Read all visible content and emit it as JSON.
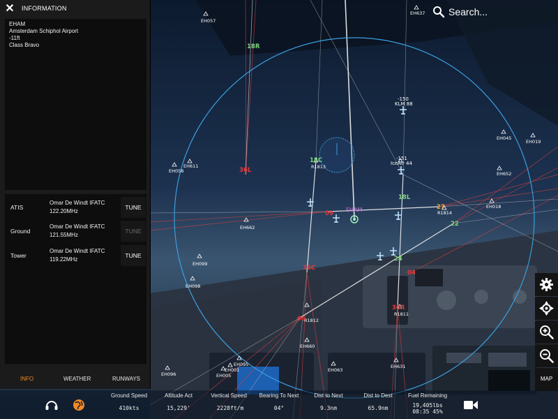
{
  "colors": {
    "accent": "#f08a2a",
    "runway_label": "#e53a3a",
    "runway_label_lit": "#7dd67d",
    "runway_label_orange": "#f0a030",
    "radius_circle": "#3a9fe0",
    "waypoint_text": "#ffffff"
  },
  "info_panel": {
    "close_icon": "close-icon",
    "title": "INFORMATION",
    "airport": {
      "icao": "EHAM",
      "name": "Amsterdam Schiphol Airport",
      "elevation": "-11ft",
      "class": "Class Bravo"
    },
    "frequencies": [
      {
        "type": "ATIS",
        "controller": "Omar De Windt IFATC",
        "mhz": "122.20MHz",
        "tune_label": "TUNE",
        "enabled": true
      },
      {
        "type": "Ground",
        "controller": "Omar De Windt IFATC",
        "mhz": "121.55MHz",
        "tune_label": "TUNE",
        "enabled": false
      },
      {
        "type": "Tower",
        "controller": "Omar De Windt IFATC",
        "mhz": "119.22MHz",
        "tune_label": "TUNE",
        "enabled": true
      }
    ],
    "tabs": [
      {
        "label": "INFO",
        "active": true
      },
      {
        "label": "WEATHER",
        "active": false
      },
      {
        "label": "RUNWAYS",
        "active": false
      }
    ]
  },
  "search": {
    "icon": "search-icon",
    "label": "Search..."
  },
  "side_buttons": [
    {
      "name": "settings-gear-icon"
    },
    {
      "name": "center-crosshair-icon"
    },
    {
      "name": "zoom-in-icon"
    },
    {
      "name": "zoom-out-icon"
    },
    {
      "name": "map-button",
      "label": "MAP"
    }
  ],
  "map": {
    "airport_label": "EHAM",
    "waypoints": [
      "EH057",
      "EH637",
      "EH045",
      "EH019",
      "EH058",
      "EH611",
      "EH652",
      "EH018",
      "EH662",
      "EH099",
      "EH098",
      "EH660",
      "EH096",
      "EH095",
      "EH001",
      "EH005",
      "EH063",
      "EH631"
    ],
    "radials": [
      "R1813",
      "R1814",
      "R1812",
      "R1811"
    ],
    "runway_labels": [
      "18R",
      "36L",
      "18C",
      "18L",
      "27",
      "22",
      "24",
      "36C",
      "04",
      "36R",
      "09",
      "06"
    ],
    "traffic": [
      {
        "alt": "-150",
        "callsign": "KLM 88"
      },
      {
        "alt": "-151",
        "callsign": "IceAir 44"
      }
    ]
  },
  "bottom_bar": {
    "stats": [
      {
        "label": "Ground Speed",
        "value": "410kts"
      },
      {
        "label": "Altitude Act",
        "value": "15,229'"
      },
      {
        "label": "Vertical Speed",
        "value": "2228ft/m"
      },
      {
        "label": "Bearing To Next",
        "value": "04°"
      },
      {
        "label": "Dist to Next",
        "value": "9.3nm"
      },
      {
        "label": "Dist to Dest",
        "value": "65.9nm"
      },
      {
        "label": "Fuel Remaining",
        "value": "19,405lbs",
        "value2": "08:35 45%"
      }
    ],
    "icons": [
      "headset-icon",
      "globe-icon",
      "camera-icon"
    ]
  }
}
